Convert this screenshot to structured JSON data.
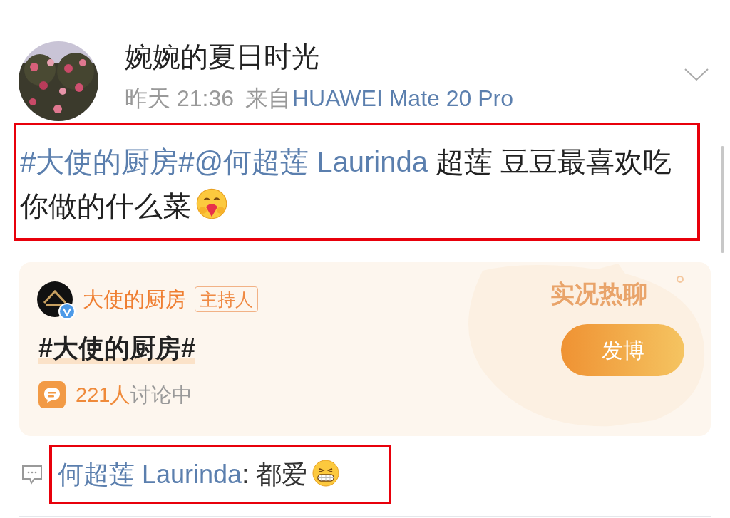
{
  "post": {
    "author": "婉婉的夏日时光",
    "time": "昨天 21:36",
    "source_prefix": "来自",
    "source": "HUAWEI Mate 20 Pro",
    "segments": [
      {
        "kind": "topic",
        "text": "#大使的厨房#"
      },
      {
        "kind": "mention",
        "text": "@何超莲 Laurinda"
      },
      {
        "kind": "plain",
        "text": " 超莲 豆豆最喜欢吃你做的什么菜"
      },
      {
        "kind": "hug"
      }
    ]
  },
  "topic_card": {
    "host": "大使的厨房",
    "host_badge": "主持人",
    "title": "#大使的厨房#",
    "count": "221人",
    "count_suffix": "讨论中",
    "tag": "实况热聊",
    "button": "发博"
  },
  "comment": {
    "segments": [
      {
        "kind": "mention",
        "text": "何超莲 Laurinda"
      },
      {
        "kind": "plain",
        "text": ": 都爱"
      },
      {
        "kind": "grin"
      }
    ]
  }
}
